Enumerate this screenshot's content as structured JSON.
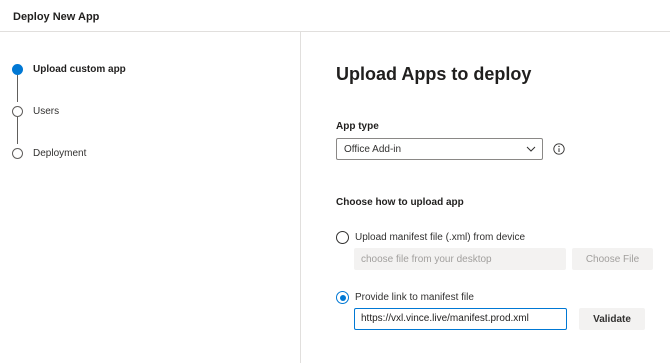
{
  "window": {
    "title": "Deploy New App"
  },
  "steps": [
    {
      "label": "Upload custom app",
      "state": "active"
    },
    {
      "label": "Users",
      "state": "pending"
    },
    {
      "label": "Deployment",
      "state": "pending"
    }
  ],
  "main": {
    "title": "Upload Apps to deploy",
    "app_type": {
      "label": "App type",
      "selected": "Office Add-in",
      "info_icon": "info-icon"
    },
    "upload_section": {
      "label": "Choose how to upload app",
      "option_device": {
        "label": "Upload manifest file (.xml) from device",
        "checked": false,
        "input_placeholder": "choose file from your desktop",
        "button_label": "Choose File"
      },
      "option_link": {
        "label": "Provide link to manifest file",
        "checked": true,
        "input_value": "https://vxl.vince.live/manifest.prod.xml",
        "button_label": "Validate"
      }
    }
  },
  "colors": {
    "accent": "#0078d4",
    "border": "#e1dfdd",
    "disabled_bg": "#f3f2f1",
    "disabled_text": "#a19f9d"
  }
}
